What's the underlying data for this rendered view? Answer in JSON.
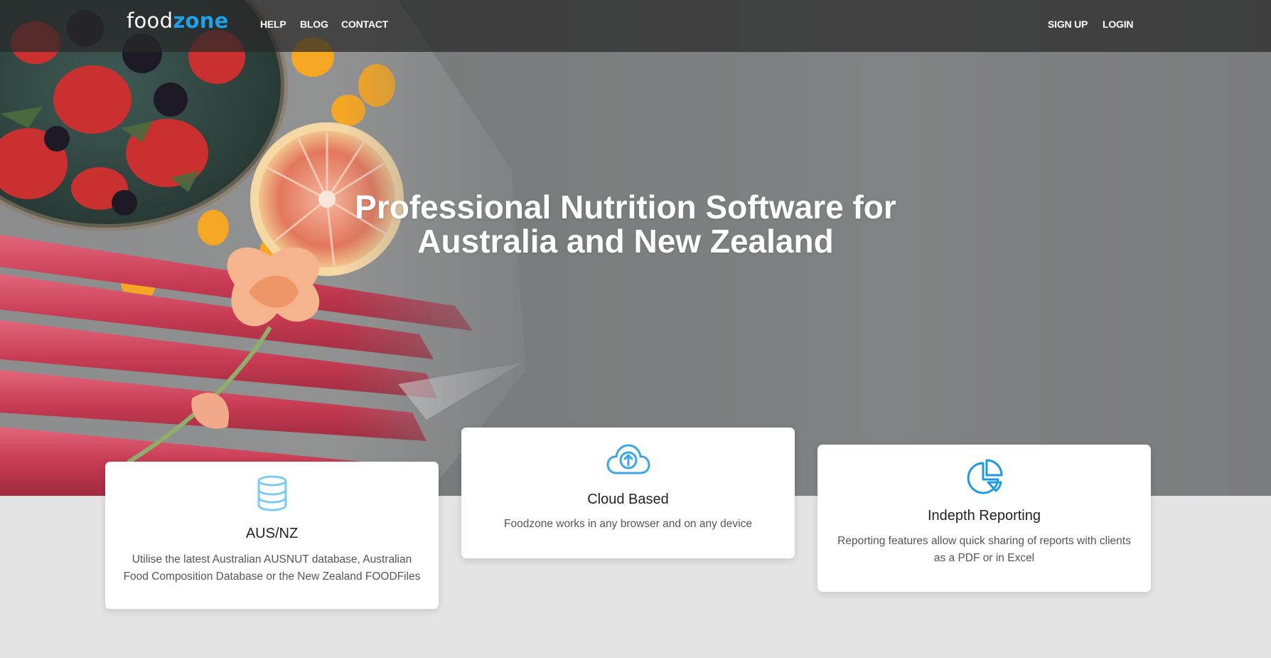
{
  "brand": {
    "logo_part1": "food",
    "logo_part2": "zone",
    "accent": "#1ea1e8"
  },
  "nav": {
    "left": [
      {
        "label": "HELP"
      },
      {
        "label": "BLOG"
      },
      {
        "label": "CONTACT"
      }
    ],
    "right": [
      {
        "label": "SIGN UP"
      },
      {
        "label": "LOGIN"
      }
    ]
  },
  "hero": {
    "line1": "Professional Nutrition Software for",
    "line2": "Australia and New Zealand"
  },
  "features": [
    {
      "icon": "database-icon",
      "title": "AUS/NZ",
      "desc_line1": "Utilise the latest Australian AUSNUT database, Australian",
      "desc_line2": "Food Composition Database or the New Zealand FOODFiles"
    },
    {
      "icon": "cloud-upload-icon",
      "title": "Cloud Based",
      "desc_line1": "Foodzone works in any browser and on any device"
    },
    {
      "icon": "pie-chart-icon",
      "title": "Indepth Reporting",
      "desc_line1": "Reporting features allow quick sharing of reports with clients",
      "desc_line2": "as a PDF or in Excel"
    }
  ]
}
